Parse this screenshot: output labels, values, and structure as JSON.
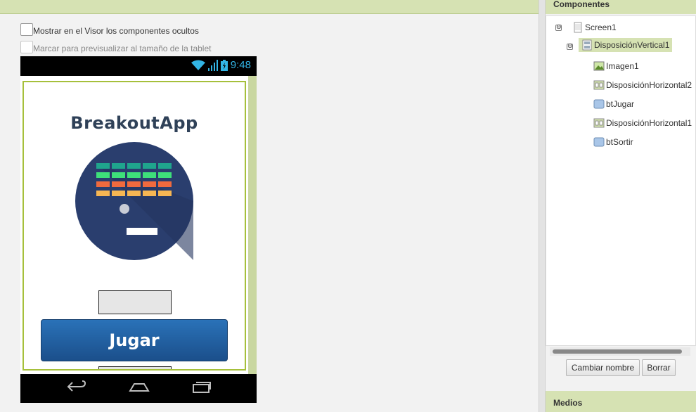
{
  "viewer": {
    "show_hidden_label": "Mostrar en el Visor los componentes ocultos",
    "tablet_preview_label": "Marcar para previsualizar al tamaño de la tablet"
  },
  "phone": {
    "time": "9:48",
    "app_title": "BreakoutApp",
    "play_button": "Jugar",
    "colors": {
      "accent": "#a6c03b",
      "button": "#1f5fa0",
      "logo_bg": "#2a3e6e",
      "status": "#33b5e5"
    }
  },
  "components": {
    "header": "Componentes",
    "tree": [
      {
        "label": "Screen1",
        "toggle": "⊖"
      },
      {
        "label": "DisposiciónVertical1",
        "toggle": "⊖"
      },
      {
        "label": "Imagen1"
      },
      {
        "label": "DisposiciónHorizontal2"
      },
      {
        "label": "btJugar"
      },
      {
        "label": "DisposiciónHorizontal1"
      },
      {
        "label": "btSortir"
      }
    ],
    "rename_button": "Cambiar nombre",
    "delete_button": "Borrar"
  },
  "media": {
    "header": "Medios"
  }
}
